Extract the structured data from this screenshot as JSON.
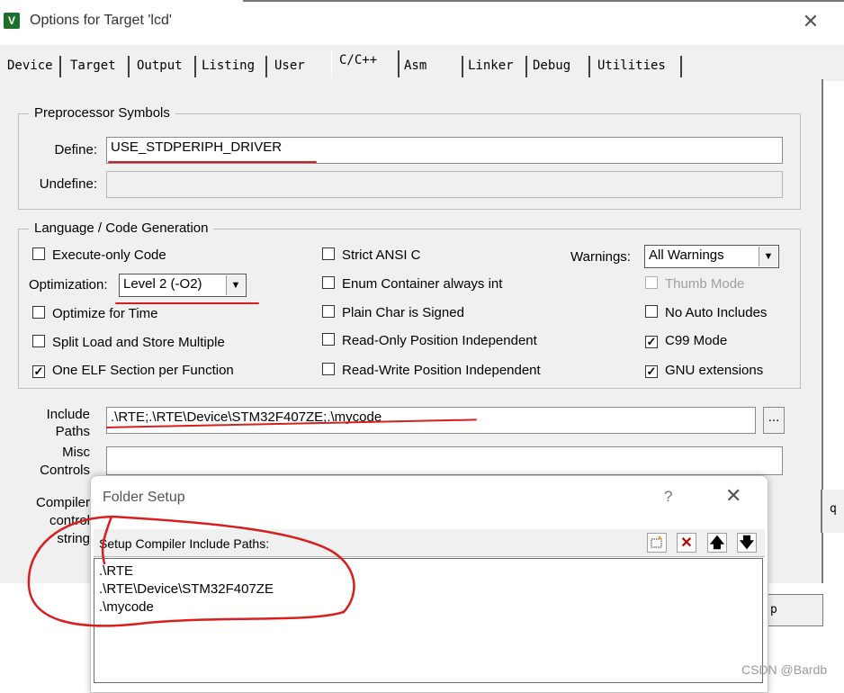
{
  "window": {
    "title": "Options for Target 'lcd'",
    "icon_name": "keil-app-icon",
    "close_glyph": "✕"
  },
  "tabs": [
    {
      "label": "Device"
    },
    {
      "label": "Target"
    },
    {
      "label": "Output"
    },
    {
      "label": "Listing"
    },
    {
      "label": "User"
    },
    {
      "label": "C/C++",
      "active": true
    },
    {
      "label": "Asm"
    },
    {
      "label": "Linker"
    },
    {
      "label": "Debug"
    },
    {
      "label": "Utilities"
    }
  ],
  "preprocessor": {
    "group_title": "Preprocessor Symbols",
    "define_label": "Define:",
    "define_value": "USE_STDPERIPH_DRIVER",
    "undefine_label": "Undefine:",
    "undefine_value": ""
  },
  "language": {
    "group_title": "Language / Code Generation",
    "execute_only": {
      "label": "Execute-only Code",
      "checked": false
    },
    "optimization_label": "Optimization:",
    "optimization_value": "Level 2 (-O2)",
    "optimize_time": {
      "label": "Optimize for Time",
      "checked": false
    },
    "split_load": {
      "label": "Split Load and Store Multiple",
      "checked": false
    },
    "one_elf": {
      "label": "One ELF Section per Function",
      "checked": true
    },
    "strict_ansi": {
      "label": "Strict ANSI C",
      "checked": false
    },
    "enum_container": {
      "label": "Enum Container always int",
      "checked": false
    },
    "plain_char": {
      "label": "Plain Char is Signed",
      "checked": false
    },
    "ropi": {
      "label": "Read-Only Position Independent",
      "checked": false
    },
    "rwpi": {
      "label": "Read-Write Position Independent",
      "checked": false
    },
    "warnings_label": "Warnings:",
    "warnings_value": "All Warnings",
    "thumb_mode": {
      "label": "Thumb Mode",
      "checked": false,
      "disabled": true
    },
    "no_auto_includes": {
      "label": "No Auto Includes",
      "checked": false
    },
    "c99_mode": {
      "label": "C99 Mode",
      "checked": true
    },
    "gnu_ext": {
      "label": "GNU extensions",
      "checked": true
    }
  },
  "include": {
    "label_line1": "Include",
    "label_line2": "Paths",
    "value": ".\\RTE;.\\RTE\\Device\\STM32F407ZE;.\\mycode",
    "browse_label": "...",
    "misc_line1": "Misc",
    "misc_line2": "Controls",
    "misc_value": "",
    "compiler_line1": "Compiler",
    "compiler_line2": "control",
    "compiler_line3": "string"
  },
  "folder_setup": {
    "title": "Folder Setup",
    "help_glyph": "?",
    "close_glyph": "✕",
    "header_label": "Setup Compiler Include Paths:",
    "toolbar": [
      "new-folder-icon",
      "delete-icon",
      "move-up-icon",
      "move-down-icon"
    ],
    "paths": [
      ".\\RTE",
      ".\\RTE\\Device\\STM32F407ZE",
      ".\\mycode"
    ]
  },
  "peek": {
    "button_fragment": "p",
    "edge_fragment": "q"
  },
  "watermark": "CSDN @Bardb",
  "colors": {
    "annotation_red": "#d81e1e",
    "dialog_bg": "#f0f0f0"
  }
}
